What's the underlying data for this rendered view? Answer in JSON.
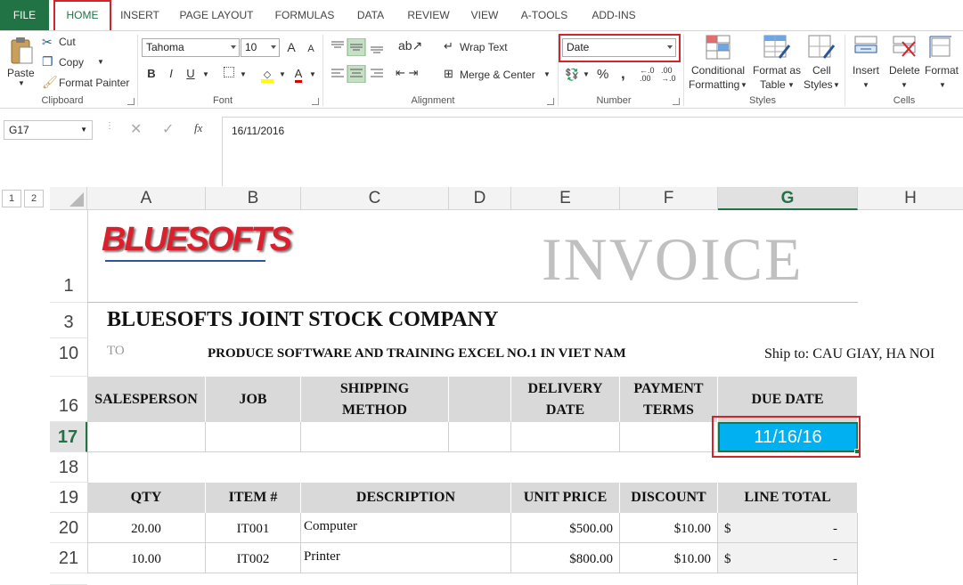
{
  "ribbon_tabs": [
    "FILE",
    "HOME",
    "INSERT",
    "PAGE LAYOUT",
    "FORMULAS",
    "DATA",
    "REVIEW",
    "VIEW",
    "A-TOOLS",
    "ADD-INS"
  ],
  "clipboard": {
    "paste": "Paste",
    "cut": "Cut",
    "copy": "Copy",
    "format_painter": "Format Painter",
    "group": "Clipboard"
  },
  "font": {
    "name": "Tahoma",
    "size": "10",
    "bold": "B",
    "italic": "I",
    "underline": "U",
    "grow": "A",
    "shrink": "A",
    "group": "Font"
  },
  "alignment": {
    "wrap": "Wrap Text",
    "merge": "Merge & Center",
    "group": "Alignment"
  },
  "number": {
    "format": "Date",
    "percent": "%",
    "comma": ",",
    "group": "Number"
  },
  "styles": {
    "conditional": [
      "Conditional",
      "Formatting"
    ],
    "format_table": [
      "Format as",
      "Table"
    ],
    "cell_styles": [
      "Cell",
      "Styles"
    ],
    "group": "Styles"
  },
  "cells": {
    "insert": "Insert",
    "delete": "Delete",
    "format": "Format",
    "group": "Cells"
  },
  "formula_bar": {
    "name_box": "G17",
    "fx": "fx",
    "value": "16/11/2016"
  },
  "outline": [
    "1",
    "2"
  ],
  "columns": [
    "A",
    "B",
    "C",
    "D",
    "E",
    "F",
    "G",
    "H"
  ],
  "rows": [
    "1",
    "3",
    "10",
    "16",
    "17",
    "18",
    "19",
    "20",
    "21"
  ],
  "sheet": {
    "logo": "BLUESOFTS",
    "invoice": "INVOICE",
    "company": "BLUESOFTS JOINT STOCK COMPANY",
    "to": "TO",
    "slogan": "PRODUCE SOFTWARE AND TRAINING EXCEL NO.1 IN VIET NAM",
    "ship_to": "Ship to: CAU GIAY, HA NOI",
    "header1": {
      "salesperson": "SALESPERSON",
      "job": "JOB",
      "shipping_1": "SHIPPING",
      "shipping_2": "METHOD",
      "delivery_1": "DELIVERY",
      "delivery_2": "DATE",
      "payment_1": "PAYMENT",
      "payment_2": "TERMS",
      "due": "DUE DATE"
    },
    "due_date_value": "11/16/16",
    "header2": {
      "qty": "QTY",
      "item": "ITEM #",
      "desc": "DESCRIPTION",
      "price": "UNIT PRICE",
      "discount": "DISCOUNT",
      "total": "LINE TOTAL"
    },
    "items": [
      {
        "qty": "20.00",
        "item": "IT001",
        "desc": "Computer",
        "price": "$500.00",
        "discount": "$10.00",
        "cur": "$",
        "total": "-"
      },
      {
        "qty": "10.00",
        "item": "IT002",
        "desc": "Printer",
        "price": "$800.00",
        "discount": "$10.00",
        "cur": "$",
        "total": "-"
      }
    ]
  },
  "colors": {
    "excel_green": "#217346",
    "highlight_red": "#d0252c",
    "selected_cell_fill": "#00b0f0",
    "header_fill": "#d9d9d9"
  }
}
